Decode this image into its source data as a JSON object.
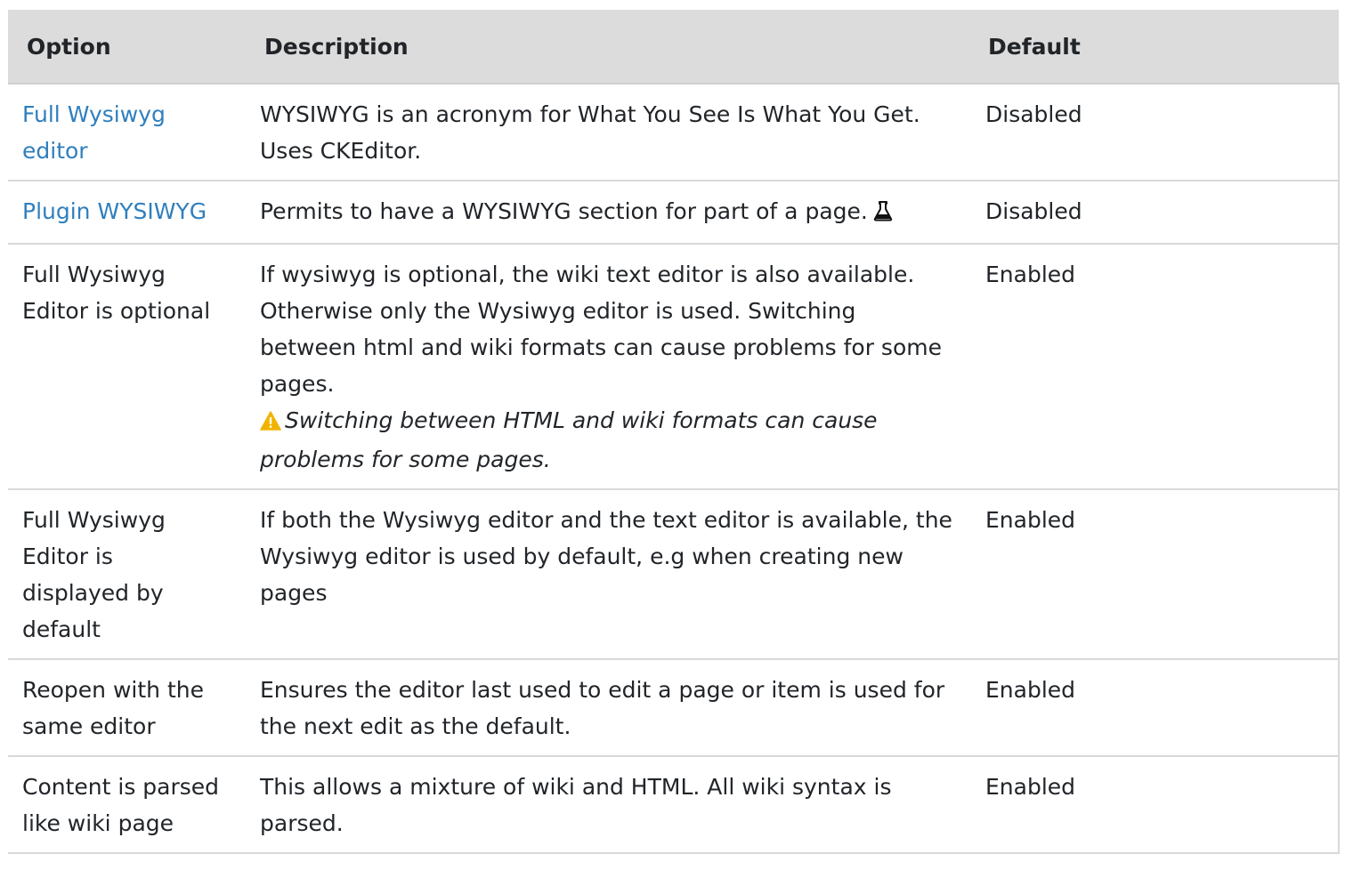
{
  "table": {
    "headers": {
      "option": "Option",
      "description": "Description",
      "default": "Default"
    },
    "rows": [
      {
        "option": "Full Wysiwyg editor",
        "option_is_link": true,
        "description": "WYSIWYG is an acronym for What You See Is What You Get. Uses CKEditor.",
        "default": "Disabled"
      },
      {
        "option": "Plugin WYSIWYG",
        "option_is_link": true,
        "description": "Permits to have a WYSIWYG section for part of a page.",
        "description_icon": "experimental-beaker-icon",
        "default": "Disabled"
      },
      {
        "option": "Full Wysiwyg Editor is optional",
        "option_is_link": false,
        "description": "If wysiwyg is optional, the wiki text editor is also available. Otherwise only the Wysiwyg editor is used. Switching between html and wiki formats can cause problems for some pages.",
        "warning_icon": "warning-icon",
        "warning": "Switching between HTML and wiki formats can cause problems for some pages.",
        "default": "Enabled"
      },
      {
        "option": "Full Wysiwyg Editor is displayed by default",
        "option_is_link": false,
        "description": "If both the Wysiwyg editor and the text editor is available, the Wysiwyg editor is used by default, e.g when creating new pages",
        "default": "Enabled"
      },
      {
        "option": "Reopen with the same editor",
        "option_is_link": false,
        "description": "Ensures the editor last used to edit a page or item is used for the next edit as the default.",
        "default": "Enabled"
      },
      {
        "option": "Content is parsed like wiki page",
        "option_is_link": false,
        "description": "This allows a mixture of wiki and HTML. All wiki syntax is parsed.",
        "default": "Enabled"
      }
    ]
  },
  "colors": {
    "link": "#2f7fbd",
    "header_bg": "#dcdcdc",
    "warning": "#f0b400"
  }
}
